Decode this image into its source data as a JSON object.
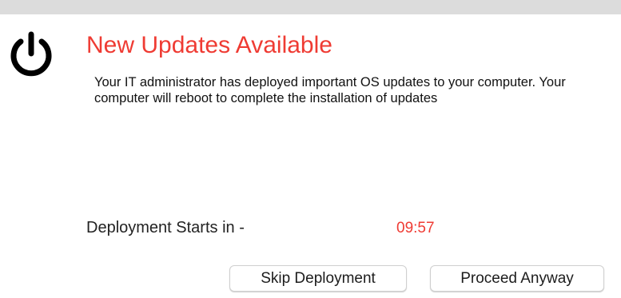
{
  "dialog": {
    "title": "New Updates Available",
    "message": "Your IT administrator has deployed important OS updates to your computer. Your computer will reboot to complete the installation of updates",
    "icon": "power-icon"
  },
  "countdown": {
    "label": "Deployment Starts in -",
    "value": "09:57"
  },
  "buttons": {
    "skip_label": "Skip Deployment",
    "proceed_label": "Proceed Anyway"
  },
  "colors": {
    "accent": "#ef3b33",
    "titlebar": "#dcdcdc",
    "background": "#ffffff"
  }
}
